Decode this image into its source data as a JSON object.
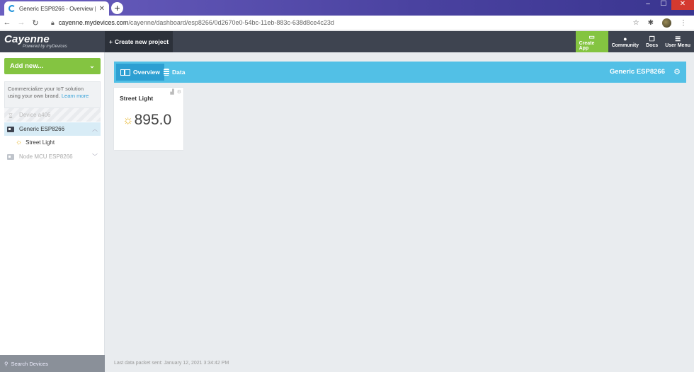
{
  "browser": {
    "tab_title": "Generic ESP8266 - Overview | my",
    "url_host": "cayenne.mydevices.com",
    "url_path": "/cayenne/dashboard/esp8266/0d2670e0-54bc-11eb-883c-638d8ce4c23d"
  },
  "header": {
    "logo": "Cayenne",
    "logo_sub": "Powered by myDevices",
    "create_project": "Create new project",
    "nav": [
      {
        "label": "Create App",
        "icon": "monitor-icon"
      },
      {
        "label": "Community",
        "icon": "chat-icon"
      },
      {
        "label": "Docs",
        "icon": "docs-icon"
      },
      {
        "label": "User Menu",
        "icon": "menu-icon"
      }
    ]
  },
  "sidebar": {
    "add_new": "Add new...",
    "promo_text": "Commercialize your IoT solution using your own brand.",
    "promo_link": "Learn more",
    "devices": [
      {
        "label": "Device a406"
      },
      {
        "label": "Generic ESP8266"
      },
      {
        "label": "Street Light"
      },
      {
        "label": "Node MCU ESP8266"
      }
    ],
    "search": "Search Devices"
  },
  "toolbar": {
    "tab_overview": "Overview",
    "tab_data": "Data",
    "device_title": "Generic ESP8266"
  },
  "widget": {
    "title": "Street Light",
    "value": "895.0"
  },
  "footer": {
    "last_packet": "Last data packet sent: January 12, 2021 3:34:42 PM"
  },
  "colors": {
    "green": "#84c441",
    "blue": "#52c0e6",
    "header": "#3e4450"
  }
}
